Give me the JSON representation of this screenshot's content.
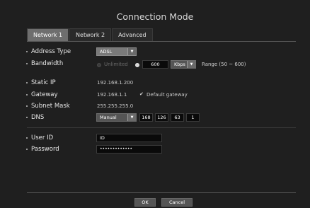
{
  "dialog": {
    "title": "Connection Mode"
  },
  "tabs": [
    {
      "label": "Network 1",
      "active": true
    },
    {
      "label": "Network 2",
      "active": false
    },
    {
      "label": "Advanced",
      "active": false
    }
  ],
  "address_type": {
    "label": "Address Type",
    "value": "ADSL"
  },
  "bandwidth": {
    "label": "Bandwidth",
    "unlimited_label": "Unlimited",
    "value": "600",
    "unit": "Kbps",
    "range_text": "Range (50 ~ 600)"
  },
  "static_ip": {
    "label": "Static IP",
    "value": "192.168.1.200"
  },
  "gateway": {
    "label": "Gateway",
    "value": "192.168.1.1",
    "default_label": "Default gateway"
  },
  "subnet_mask": {
    "label": "Subnet Mask",
    "value": "255.255.255.0"
  },
  "dns": {
    "label": "DNS",
    "mode": "Manual",
    "octets": [
      "168",
      "126",
      "63",
      "1"
    ]
  },
  "user_id": {
    "label": "User ID",
    "value": "ID"
  },
  "password": {
    "label": "Password",
    "value": "•••••••••••••"
  },
  "buttons": {
    "ok": "OK",
    "cancel": "Cancel"
  },
  "colors": {
    "background": "#1f1f1f",
    "active_tab": "#6e6e6e",
    "input_bg": "#0a0a0a"
  }
}
